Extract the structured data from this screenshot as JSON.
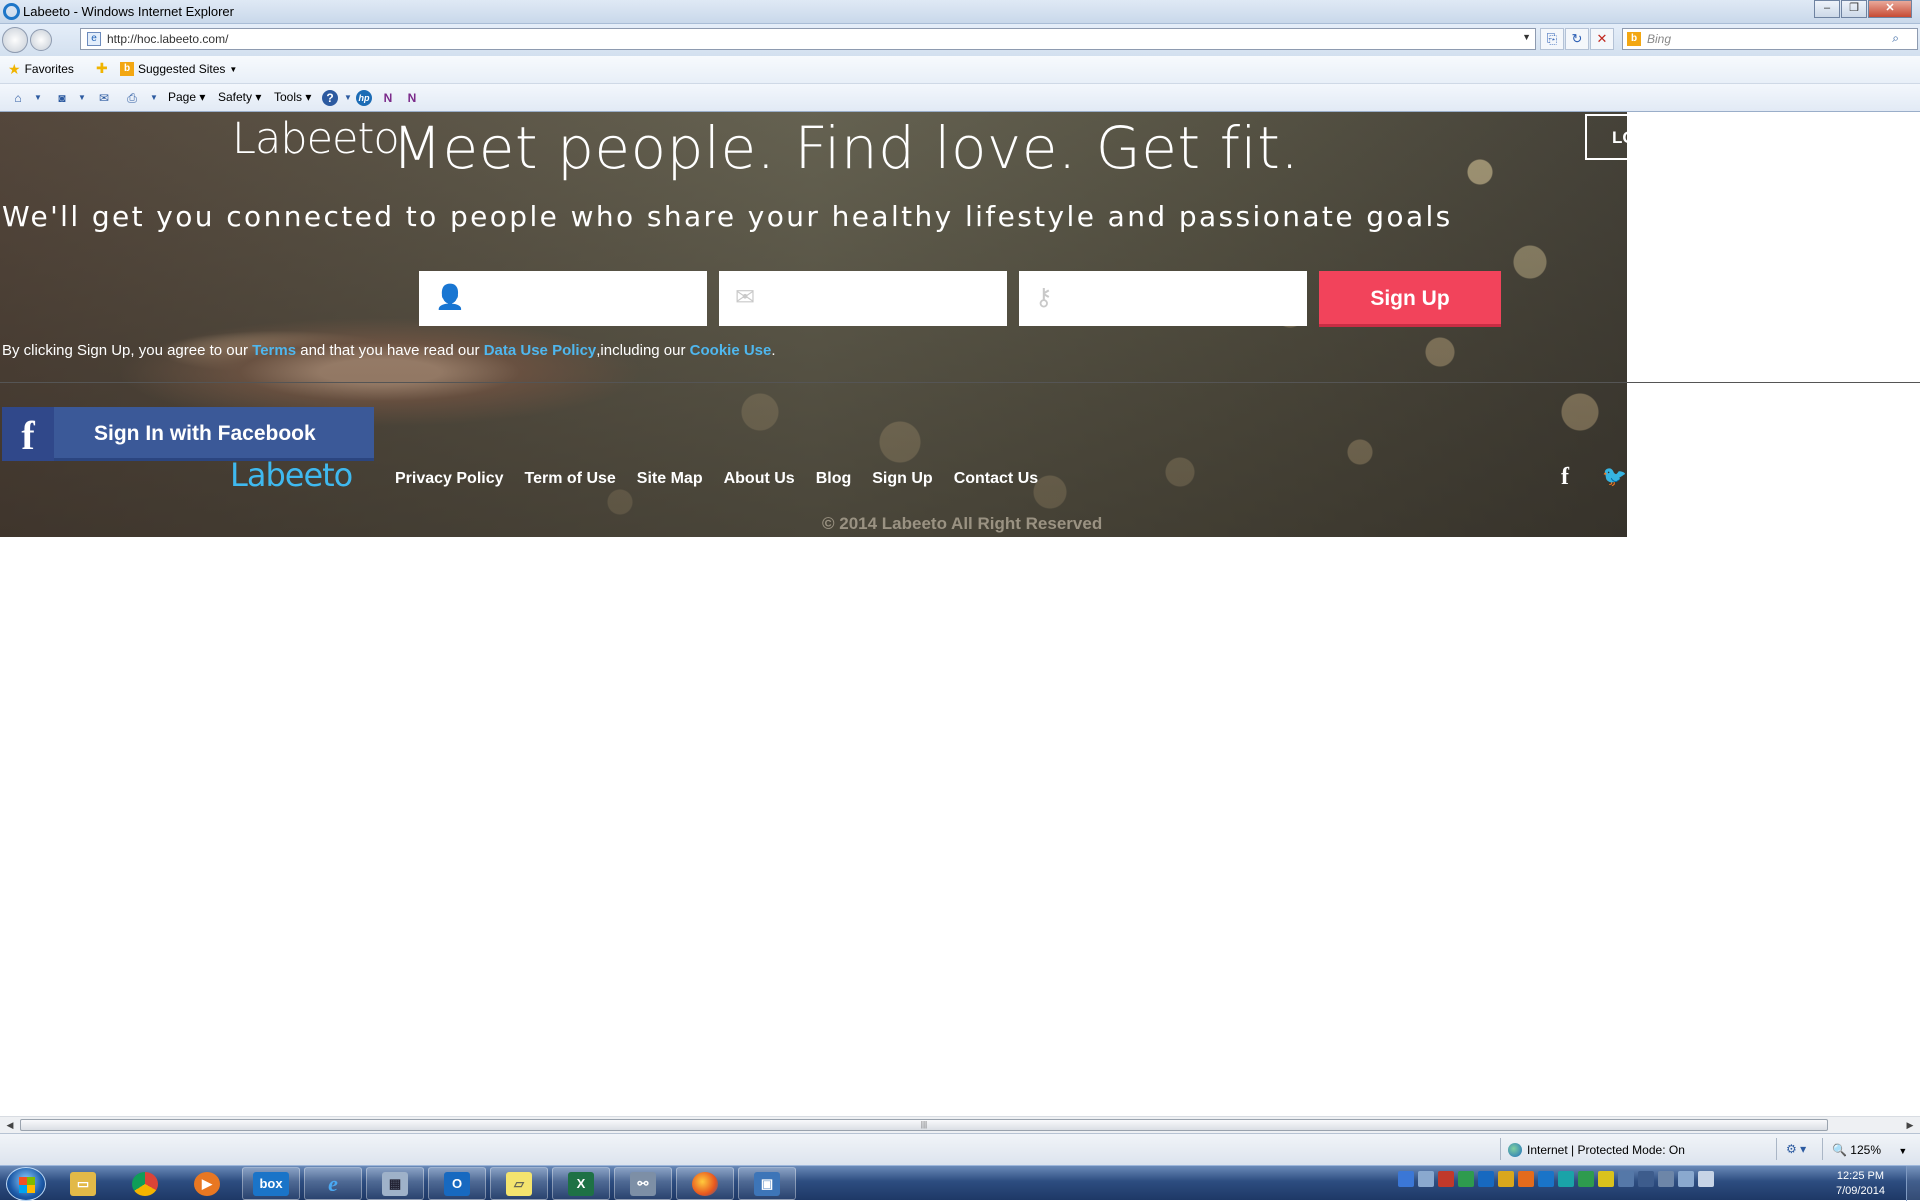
{
  "window": {
    "title": "Labeeto - Windows Internet Explorer",
    "controls": [
      "minimize",
      "restore",
      "close"
    ]
  },
  "address_bar": {
    "url": "http://hoc.labeeto.com/",
    "search_placeholder": "Bing"
  },
  "favorites_bar": {
    "favorites_label": "Favorites",
    "suggested_sites_label": "Suggested Sites"
  },
  "command_bar": {
    "page_label": "Page",
    "safety_label": "Safety",
    "tools_label": "Tools"
  },
  "site": {
    "logo": "Labeeto",
    "headline": "Meet people. Find love. Get fit.",
    "subheadline": "We'll get you connected to people who share your healthy lifestyle and passionate goals",
    "login_button": "LO",
    "signup_form": {
      "name_value": "",
      "email_value": "",
      "password_value": "",
      "submit_label": "Sign Up"
    },
    "agreement": {
      "prefix": "By clicking Sign Up, you agree to our ",
      "terms": "Terms",
      "middle": " and that you have read our ",
      "data_policy": "Data Use Policy",
      "middle2": ",including our ",
      "cookie": "Cookie Use",
      "suffix": "."
    },
    "facebook_button": "Sign In with Facebook",
    "footer_logo": "Labeeto",
    "footer_links": [
      "Privacy Policy",
      "Term of Use",
      "Site Map",
      "About Us",
      "Blog",
      "Sign Up",
      "Contact Us"
    ],
    "copyright": "© 2014 Labeeto All Right Reserved"
  },
  "status_bar": {
    "zone": "Internet | Protected Mode: On",
    "zoom": "125%"
  },
  "taskbar": {
    "apps": [
      "windows-explorer",
      "chrome",
      "media-player",
      "box",
      "internet-explorer",
      "calculator",
      "outlook",
      "sticky-notes",
      "excel",
      "network",
      "firefox",
      "remote-desktop"
    ],
    "clock_time": "12:25 PM",
    "clock_date": "7/09/2014"
  }
}
